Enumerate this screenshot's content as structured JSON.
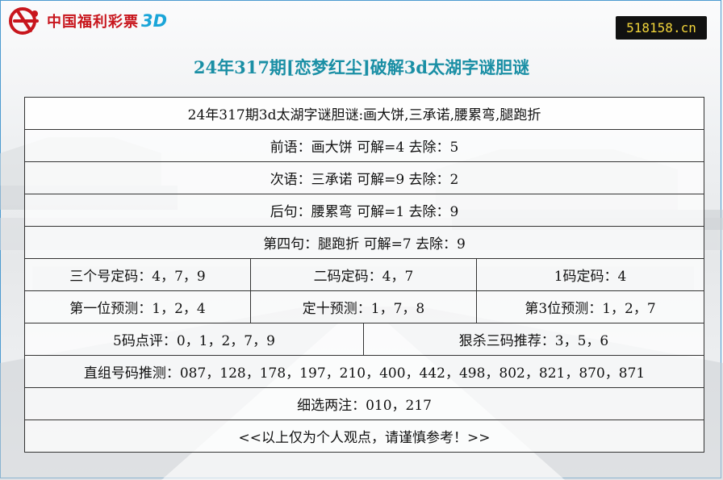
{
  "logo": {
    "text": "中国福利彩票",
    "suffix": "3D",
    "icon": "welfare-lottery-logo-icon"
  },
  "site_badge": "518158.cn",
  "title": "24年317期[恋梦红尘]破解3d太湖字谜胆谜",
  "rows": {
    "riddle": "24年317期3d太湖字谜胆谜:画大饼,三承诺,腰累弯,腿跑折",
    "qianyu": "前语：画大饼 可解=4 去除：5",
    "ciyu": "次语：三承诺 可解=9 去除：2",
    "houju": "后句：腰累弯 可解=1 去除：9",
    "disiju": "第四句：腿跑折 可解=7 去除：9",
    "three_fixed": "三个号定码：4，7，9",
    "two_fixed": "二码定码：4，7",
    "one_fixed": "1码定码：4",
    "first_pos": "第一位预测：1，2，4",
    "tens_pos": "定十预测：1，7，8",
    "third_pos": "第3位预测：1，2，7",
    "five_review": "5码点评：0，1，2，7，9",
    "kill_three": "狠杀三码推荐：3，5，6",
    "direct": "直组号码推测：087，128，178，197，210，400，442，498，802，821，870，871",
    "pick_two": "细选两注：010，217",
    "note": "<<以上仅为个人观点，请谨慎参考！>>"
  },
  "colors": {
    "title": "#1a8fa5",
    "logo_red": "#c8161d",
    "logo_blue": "#1aa5d8",
    "badge_bg": "#111111",
    "badge_text": "#f1d43a"
  }
}
